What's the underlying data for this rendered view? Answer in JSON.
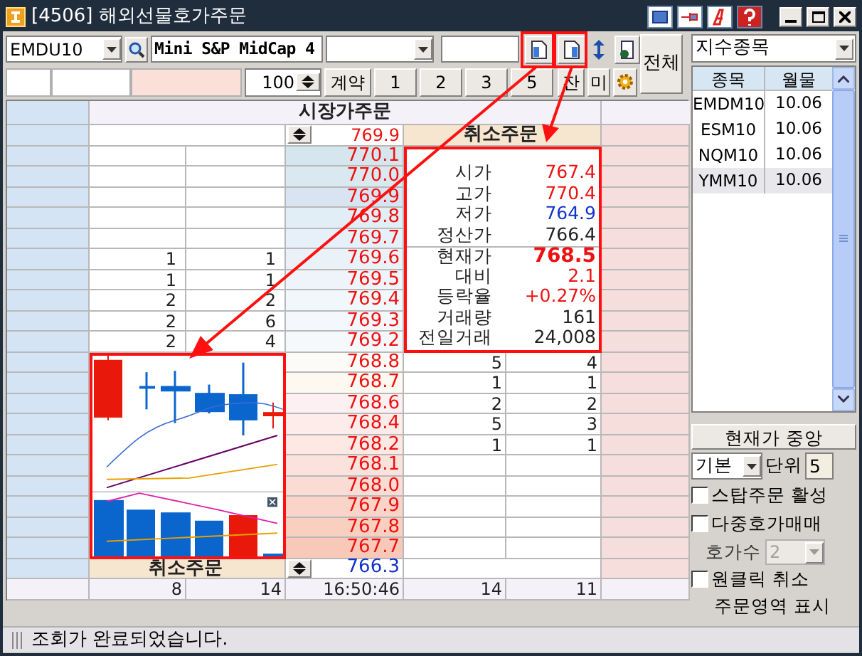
{
  "window": {
    "title": "[4506] 해외선물호가주문"
  },
  "toolbar": {
    "symbol": "EMDU10",
    "symbol_name": "Mini S&P MidCap 4",
    "quantity": "100",
    "unit_button": "계약",
    "quick_buttons": [
      "1",
      "2",
      "3",
      "5"
    ],
    "remain_button": "잔",
    "pending_button": "미",
    "all_button": "전체"
  },
  "order_book": {
    "market_order_header": "시장가주문",
    "cancel_header": "취소주문",
    "market_price": {
      "value": "769.9",
      "color": "#ee1111"
    },
    "rows": [
      {
        "price": "770.1",
        "color": "#ee1111"
      },
      {
        "price": "770.0",
        "color": "#ee1111"
      },
      {
        "price": "769.9",
        "color": "#ee1111"
      },
      {
        "price": "769.8",
        "color": "#ee1111"
      },
      {
        "price": "769.7",
        "color": "#ee1111"
      },
      {
        "price": "769.6",
        "color": "#ee1111",
        "col_2": "1",
        "col_3": "1"
      },
      {
        "price": "769.5",
        "color": "#ee1111",
        "col_2": "1",
        "col_3": "1"
      },
      {
        "price": "769.4",
        "color": "#ee1111",
        "col_2": "2",
        "col_3": "2"
      },
      {
        "price": "769.3",
        "color": "#ee1111",
        "col_2": "2",
        "col_3": "6"
      },
      {
        "price": "769.2",
        "color": "#ee1111",
        "col_2": "2",
        "col_3": "4"
      },
      {
        "price": "768.8",
        "color": "#ee1111",
        "col_5": "5",
        "col_6": "4"
      },
      {
        "price": "768.7",
        "color": "#ee1111",
        "col_5": "1",
        "col_6": "1"
      },
      {
        "price": "768.6",
        "color": "#ee1111",
        "col_5": "2",
        "col_6": "2"
      },
      {
        "price": "768.4",
        "color": "#ee1111",
        "col_5": "5",
        "col_6": "3"
      },
      {
        "price": "768.2",
        "color": "#ee1111",
        "col_5": "1",
        "col_6": "1"
      },
      {
        "price": "768.1",
        "color": "#ee1111"
      },
      {
        "price": "768.0",
        "color": "#ee1111"
      },
      {
        "price": "767.9",
        "color": "#ee1111"
      },
      {
        "price": "767.8",
        "color": "#ee1111"
      },
      {
        "price": "767.7",
        "color": "#ee1111"
      }
    ],
    "cancel_footer": "취소주문",
    "last_price": {
      "value": "766.3",
      "color": "#1133cc"
    },
    "totals": [
      "8",
      "14",
      "16:50:46",
      "14",
      "11"
    ]
  },
  "quote_box": {
    "items": [
      {
        "label": "시가",
        "value": "767.4",
        "color": "#ee1111",
        "bold": false
      },
      {
        "label": "고가",
        "value": "770.4",
        "color": "#ee1111",
        "bold": false
      },
      {
        "label": "저가",
        "value": "764.9",
        "color": "#1133cc",
        "bold": false
      },
      {
        "label": "정산가",
        "value": "766.4",
        "color": "#222222",
        "bold": false
      },
      {
        "label": "현재가",
        "value": "768.5",
        "color": "#ee1111",
        "bold": true
      },
      {
        "label": "대비",
        "value": "2.1",
        "color": "#ee1111",
        "bold": false
      },
      {
        "label": "등락율",
        "value": "+0.27%",
        "color": "#ee1111",
        "bold": false
      },
      {
        "label": "거래량",
        "value": "161",
        "color": "#222222",
        "bold": false
      },
      {
        "label": "전일거래",
        "value": "24,008",
        "color": "#222222",
        "bold": false
      }
    ]
  },
  "side_panel": {
    "category": "지수종목",
    "columns": [
      "종목",
      "월물"
    ],
    "rows": [
      {
        "symbol": "EMDM10",
        "month": "10.06",
        "selected": false
      },
      {
        "symbol": "ESM10",
        "month": "10.06",
        "selected": false
      },
      {
        "symbol": "NQM10",
        "month": "10.06",
        "selected": false
      },
      {
        "symbol": "YMM10",
        "month": "10.06",
        "selected": true
      }
    ],
    "center_button": "현재가 중앙",
    "mode": "기본",
    "unit_label": "단위",
    "unit": "5",
    "stop_order": {
      "label": "스탑주문 활성",
      "checked": false
    },
    "multi_order": {
      "label": "다중호가매매",
      "checked": false
    },
    "depth_label": "호가수",
    "depth": {
      "value": "2",
      "disabled": true
    },
    "one_click": {
      "label": "원클릭 취소",
      "sublabel": "주문영역 표시",
      "checked": false
    }
  },
  "status_bar": {
    "message": "조회가 완료되었습니다."
  }
}
